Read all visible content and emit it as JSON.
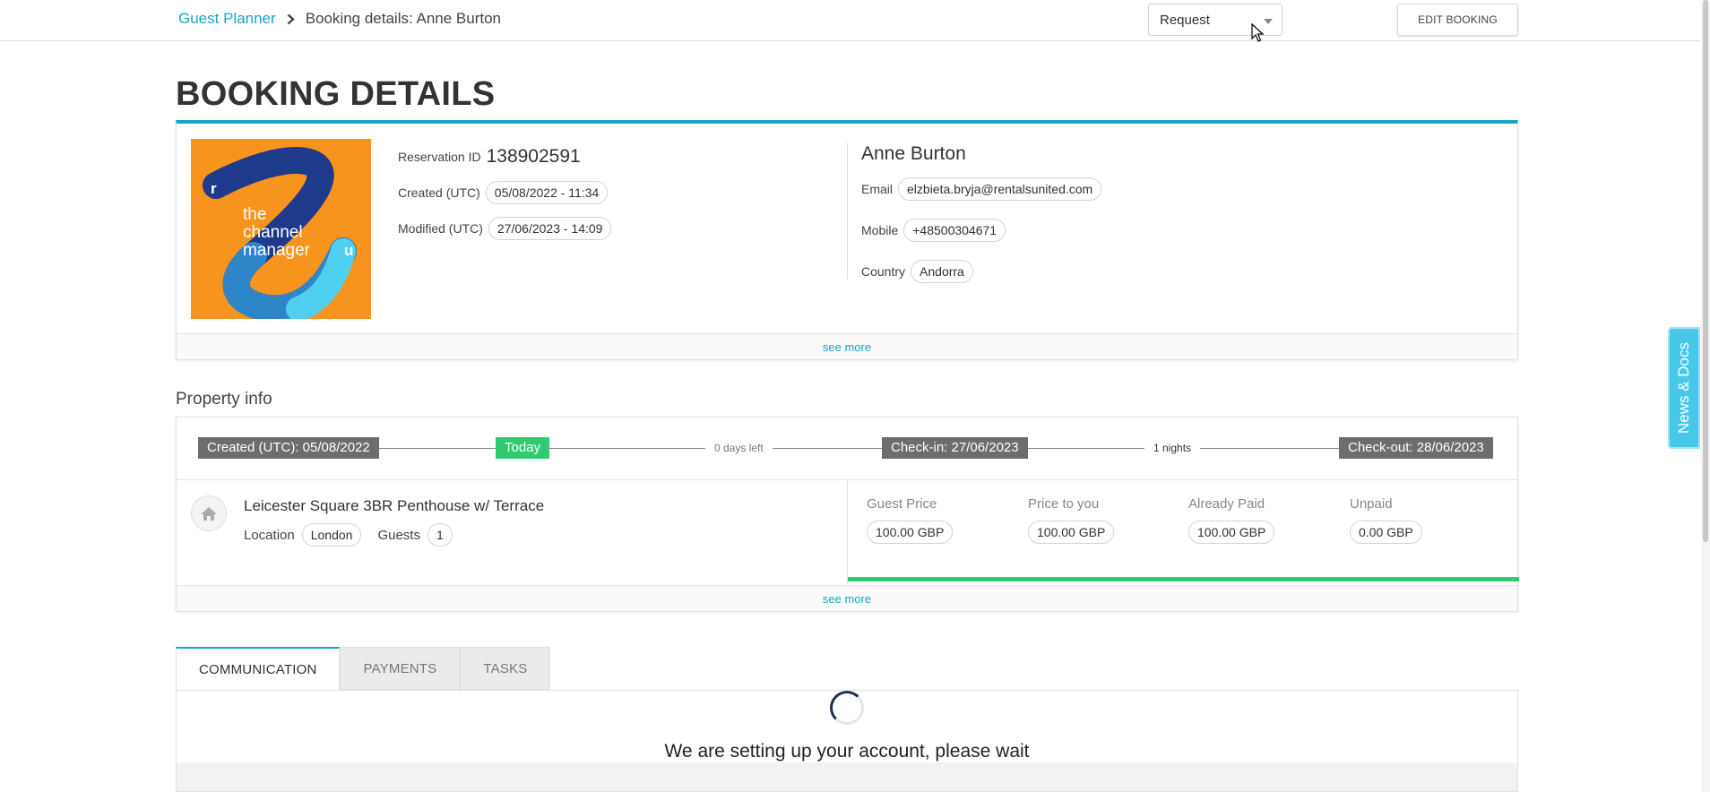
{
  "header": {
    "breadcrumb_root": "Guest Planner",
    "breadcrumb_current": "Booking details: Anne Burton",
    "status_value": "Request",
    "edit_label": "EDIT BOOKING"
  },
  "page_title": "BOOKING DETAILS",
  "booking": {
    "logo_letters": {
      "r": "r",
      "u": "u"
    },
    "logo_text": "the channel manager",
    "reservation_label": "Reservation ID",
    "reservation_id": "138902591",
    "created_label": "Created (UTC)",
    "created_value": "05/08/2022 - 11:34",
    "modified_label": "Modified (UTC)",
    "modified_value": "27/06/2023 - 14:09",
    "guest_name": "Anne Burton",
    "email_label": "Email",
    "email_value": "elzbieta.bryja@rentalsunited.com",
    "mobile_label": "Mobile",
    "mobile_value": "+48500304671",
    "country_label": "Country",
    "country_value": "Andorra",
    "see_more": "see more"
  },
  "property_section_title": "Property info",
  "property": {
    "timeline": {
      "created": "Created (UTC): 05/08/2022",
      "today": "Today",
      "days_left": "0 days left",
      "checkin": "Check-in: 27/06/2023",
      "nights": "1 nights",
      "checkout": "Check-out: 28/06/2023"
    },
    "name": "Leicester Square 3BR Penthouse w/ Terrace",
    "location_label": "Location",
    "location_value": "London",
    "guests_label": "Guests",
    "guests_value": "1",
    "prices": [
      {
        "label": "Guest Price",
        "value": "100.00 GBP"
      },
      {
        "label": "Price to you",
        "value": "100.00 GBP"
      },
      {
        "label": "Already Paid",
        "value": "100.00 GBP"
      },
      {
        "label": "Unpaid",
        "value": "0.00 GBP"
      }
    ],
    "see_more": "see more"
  },
  "tabs": [
    {
      "label": "COMMUNICATION"
    },
    {
      "label": "PAYMENTS"
    },
    {
      "label": "TASKS"
    }
  ],
  "communication": {
    "wait_message": "We are setting up your account, please wait"
  },
  "news_tab_label": "News & Docs",
  "colors": {
    "accent": "#1ba3c7",
    "success": "#2ecc71",
    "logo_bg": "#f7941d",
    "news_tab": "#47c8e8"
  }
}
